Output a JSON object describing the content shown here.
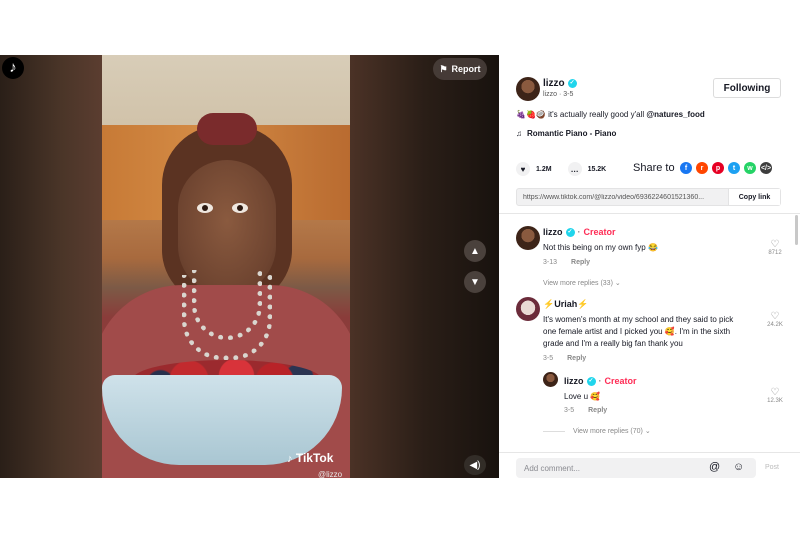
{
  "video": {
    "report_label": "Report",
    "watermark": "TikTok",
    "watermark_handle": "@lizzo"
  },
  "author": {
    "name": "lizzo",
    "subline": "lizzo · 3-5",
    "follow_label": "Following"
  },
  "post": {
    "emojis": "🍇🍓🥥",
    "caption": " it's actually really good y'all ",
    "mention": "@natures_food",
    "music_icon": "♫",
    "music": "Romantic Piano - Piano"
  },
  "stats": {
    "likes": "1.2M",
    "comments": "15.2K",
    "share_label": "Share to"
  },
  "share_icons": [
    {
      "name": "facebook-icon",
      "glyph": "f",
      "color": "#1877f2"
    },
    {
      "name": "reddit-icon",
      "glyph": "r",
      "color": "#ff4500"
    },
    {
      "name": "pinterest-icon",
      "glyph": "p",
      "color": "#e60023"
    },
    {
      "name": "twitter-icon",
      "glyph": "t",
      "color": "#1da1f2"
    },
    {
      "name": "whatsapp-icon",
      "glyph": "w",
      "color": "#25d366"
    },
    {
      "name": "embed-icon",
      "glyph": "</>",
      "color": "#3d3d3d"
    }
  ],
  "link": {
    "url": "https://www.tiktok.com/@lizzo/video/6936224601521360...",
    "copy_label": "Copy link"
  },
  "comments": [
    {
      "name": "lizzo",
      "badge": "Creator",
      "text": "Not this being on my own fyp 😂",
      "date": "3-13",
      "reply": "Reply",
      "likes": "8712",
      "more": "View more replies (33)"
    },
    {
      "name": "⚡Uriah⚡",
      "text_lines": [
        "It's women's month at my school and they said to pick",
        "one female artist and I picked you 🥰. I'm in the sixth",
        "grade and I'm a really big fan thank you"
      ],
      "date": "3-5",
      "reply": "Reply",
      "likes": "24.2K"
    },
    {
      "name": "lizzo",
      "badge": "Creator",
      "text": "Love u 🥰",
      "date": "3-5",
      "reply": "Reply",
      "likes": "12.3K",
      "more": "View more replies (70)"
    }
  ],
  "add_comment": {
    "placeholder": "Add comment...",
    "post_label": "Post"
  }
}
